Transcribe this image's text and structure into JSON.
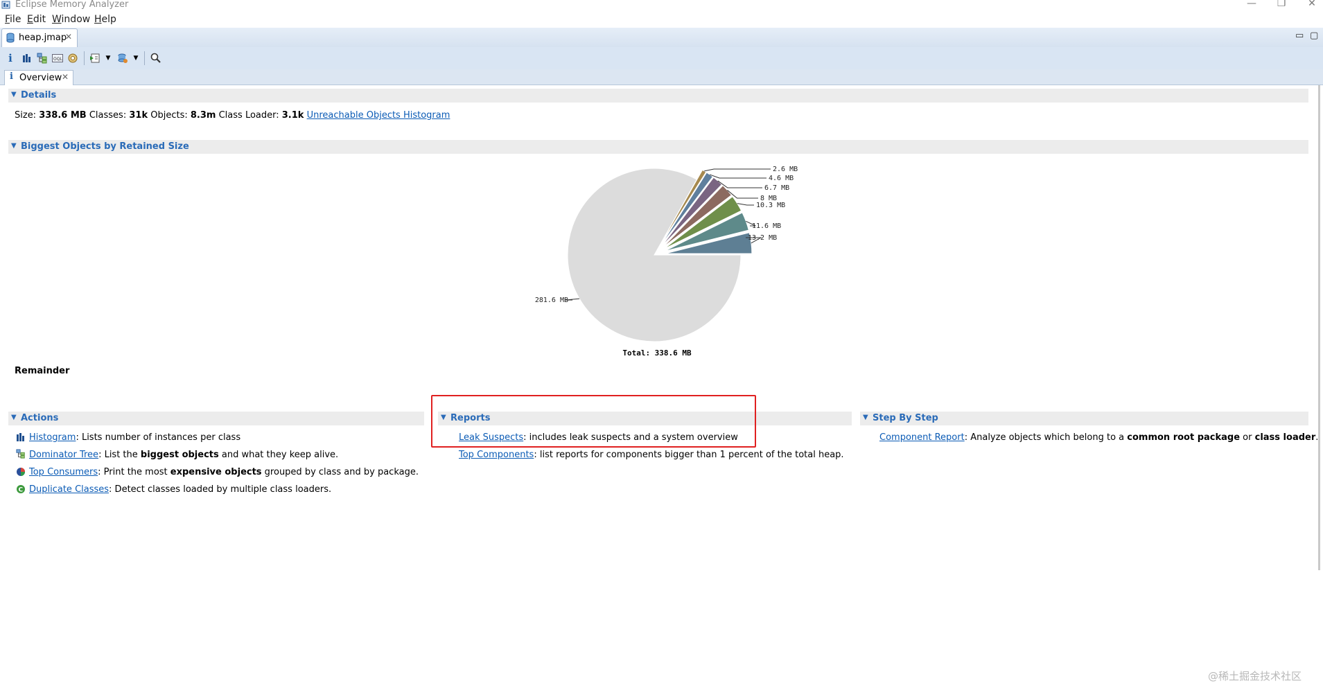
{
  "window": {
    "title": "Eclipse Memory Analyzer",
    "controls": [
      "—",
      "❐",
      "✕"
    ]
  },
  "menu": [
    "File",
    "Edit",
    "Window",
    "Help"
  ],
  "editor_tab": {
    "label": "heap.jmap"
  },
  "inner_tab": {
    "label": "Overview"
  },
  "details": {
    "header": "Details",
    "size_label": "Size:",
    "size_value": "338.6 MB",
    "classes_label": "Classes:",
    "classes_value": "31k",
    "objects_label": "Objects:",
    "objects_value": "8.3m",
    "loader_label": "Class Loader:",
    "loader_value": "3.1k",
    "histogram_link": "Unreachable Objects Histogram"
  },
  "biggest": {
    "header": "Biggest Objects by Retained Size",
    "remainder_label": "Remainder"
  },
  "chart_data": {
    "type": "pie",
    "slices": [
      {
        "label": "13.2 MB",
        "value": 13.2,
        "color": "#5e7f94"
      },
      {
        "label": "11.6 MB",
        "value": 11.6,
        "color": "#5e8a8a"
      },
      {
        "label": "10.3 MB",
        "value": 10.3,
        "color": "#6f8f4a"
      },
      {
        "label": "8 MB",
        "value": 8.0,
        "color": "#8c6a60"
      },
      {
        "label": "6.7 MB",
        "value": 6.7,
        "color": "#7a6582"
      },
      {
        "label": "4.6 MB",
        "value": 4.6,
        "color": "#5f7f9d"
      },
      {
        "label": "2.6 MB",
        "value": 2.6,
        "color": "#a6894e"
      },
      {
        "label": "281.6 MB",
        "value": 281.6,
        "color": "#dcdcdc"
      }
    ],
    "total_label": "Total: 338.6 MB"
  },
  "actions": {
    "header": "Actions",
    "items": [
      {
        "link": "Histogram",
        "parts": [
          ": Lists number of instances per class"
        ],
        "icon": "histogram-icon"
      },
      {
        "link": "Dominator Tree",
        "pre": ": List the ",
        "bold": "biggest objects",
        "post": " and what they keep alive.",
        "icon": "dominator-tree-icon"
      },
      {
        "link": "Top Consumers",
        "pre": ": Print the most ",
        "bold": "expensive objects",
        "post": " grouped by class and by package.",
        "icon": "top-consumers-icon"
      },
      {
        "link": "Duplicate Classes",
        "pre": ": Detect classes loaded by multiple class loaders.",
        "icon": "duplicate-classes-icon"
      }
    ]
  },
  "reports": {
    "header": "Reports",
    "items": [
      {
        "link": "Leak Suspects",
        "text": ": includes leak suspects and a system overview"
      },
      {
        "link": "Top Components",
        "text": ": list reports for components bigger than 1 percent of the total heap."
      }
    ]
  },
  "stepbystep": {
    "header": "Step By Step",
    "link": "Component Report",
    "pre": ": Analyze objects which belong to a ",
    "bold1": "common root package",
    "mid": " or ",
    "bold2": "class loader",
    "post": "."
  },
  "watermark": "@稀土掘金技术社区",
  "colors": {
    "accent": "#2a6bb8",
    "link": "#0b5bb5",
    "highlight": "#e02020"
  }
}
